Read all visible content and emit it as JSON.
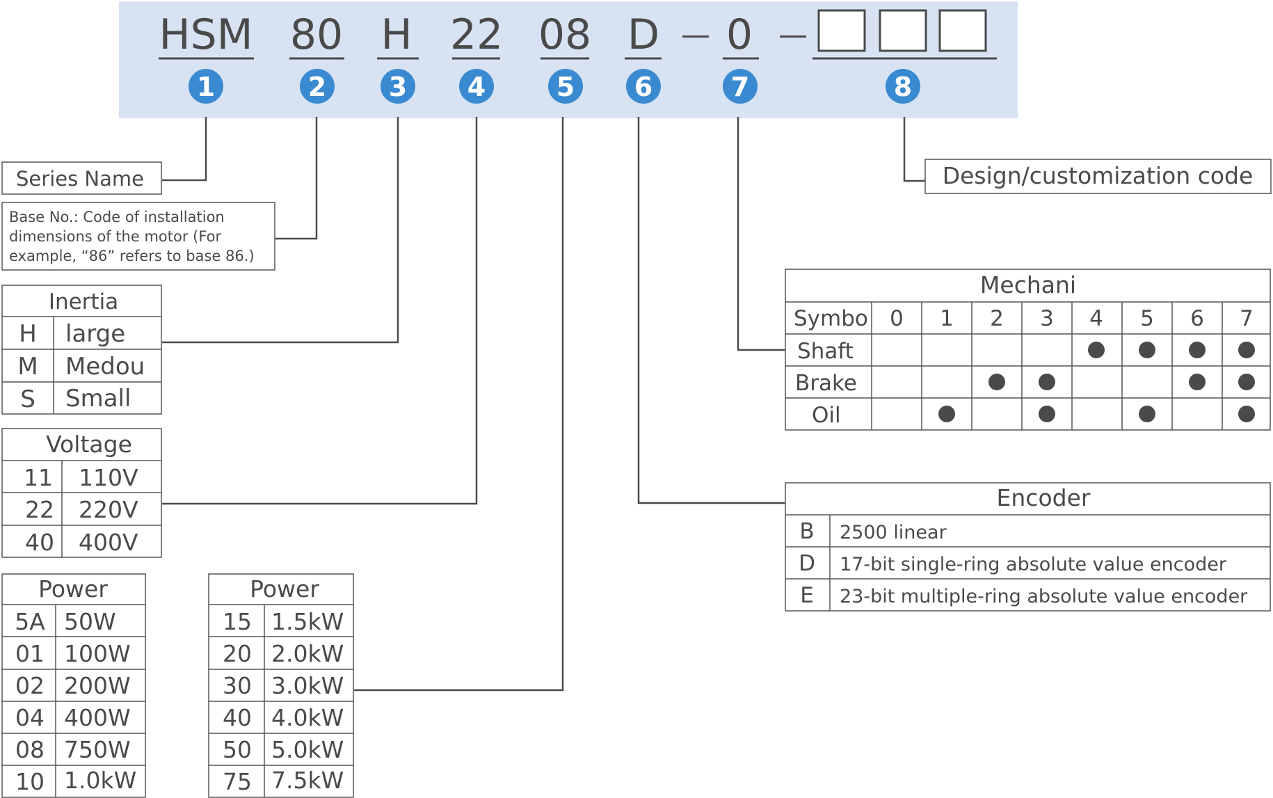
{
  "colors": {
    "banner": "#d7e3f3",
    "badge": "#3a8ad2",
    "text": "#4a4a4a"
  },
  "model_code": {
    "parts": [
      "HSM",
      "80",
      "H",
      "22",
      "08",
      "D",
      "—",
      "0",
      "—"
    ],
    "badges": [
      "1",
      "2",
      "3",
      "4",
      "5",
      "6",
      "7",
      "8"
    ]
  },
  "series_name": "Series Name",
  "base_no": [
    "Base No.: Code of installation",
    "dimensions of the motor (For",
    "example,  “86”  refers to base 86.)"
  ],
  "inertia": {
    "title": "Inertia",
    "rows": [
      [
        "H",
        "large"
      ],
      [
        "M",
        "Medou"
      ],
      [
        "S",
        "Small"
      ]
    ]
  },
  "voltage": {
    "title": "Voltage",
    "rows": [
      [
        "11",
        "110V"
      ],
      [
        "22",
        "220V"
      ],
      [
        "40",
        "400V"
      ]
    ]
  },
  "power_left": {
    "title": "Power",
    "rows": [
      [
        "5A",
        "50W"
      ],
      [
        "01",
        "100W"
      ],
      [
        "02",
        "200W"
      ],
      [
        "04",
        "400W"
      ],
      [
        "08",
        "750W"
      ],
      [
        "10",
        "1.0kW"
      ]
    ]
  },
  "power_right": {
    "title": "Power",
    "rows": [
      [
        "15",
        "1.5kW"
      ],
      [
        "20",
        "2.0kW"
      ],
      [
        "30",
        "3.0kW"
      ],
      [
        "40",
        "4.0kW"
      ],
      [
        "50",
        "5.0kW"
      ],
      [
        "75",
        "7.5kW"
      ]
    ]
  },
  "design_code": "Design/customization code",
  "mechanical": {
    "title": "Mechani",
    "symbol_label": "Symbo",
    "symbols": [
      "0",
      "1",
      "2",
      "3",
      "4",
      "5",
      "6",
      "7"
    ],
    "rows": [
      {
        "label": "Shaft",
        "dots": [
          0,
          0,
          0,
          0,
          1,
          1,
          1,
          1
        ]
      },
      {
        "label": "Brake",
        "dots": [
          0,
          0,
          1,
          1,
          0,
          0,
          1,
          1
        ]
      },
      {
        "label": "Oil",
        "dots": [
          0,
          1,
          0,
          1,
          0,
          1,
          0,
          1
        ]
      }
    ]
  },
  "encoder": {
    "title": "Encoder",
    "rows": [
      [
        "B",
        "2500 linear"
      ],
      [
        "D",
        "17-bit single-ring absolute value encoder"
      ],
      [
        "E",
        "23-bit multiple-ring absolute value encoder"
      ]
    ]
  }
}
